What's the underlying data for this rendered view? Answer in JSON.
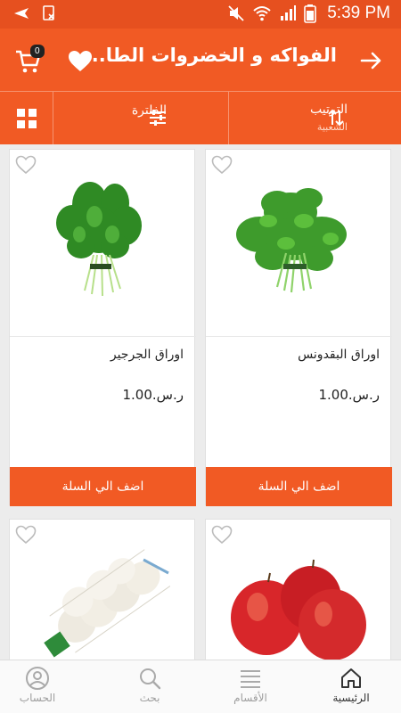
{
  "status_bar": {
    "time": "5:39 PM"
  },
  "app_bar": {
    "title": "الفواكه و الخضروات الطا...",
    "cart_count": "0"
  },
  "filter_bar": {
    "sort_label": "الترتيب",
    "sort_value": "الشعبية",
    "filter_label": "الفلترة"
  },
  "products": [
    {
      "name": "اوراق البقدونس",
      "price": "ر.س.1.00",
      "add_label": "اضف الي السلة"
    },
    {
      "name": "اوراق الجرجير",
      "price": "ر.س.1.00",
      "add_label": "اضف الي السلة"
    }
  ],
  "bottom_nav": [
    {
      "label": "الرئيسية"
    },
    {
      "label": "الأقسام"
    },
    {
      "label": "بحث"
    },
    {
      "label": "الحساب"
    }
  ],
  "colors": {
    "accent": "#f15a24",
    "status_bar": "#e6501f"
  }
}
